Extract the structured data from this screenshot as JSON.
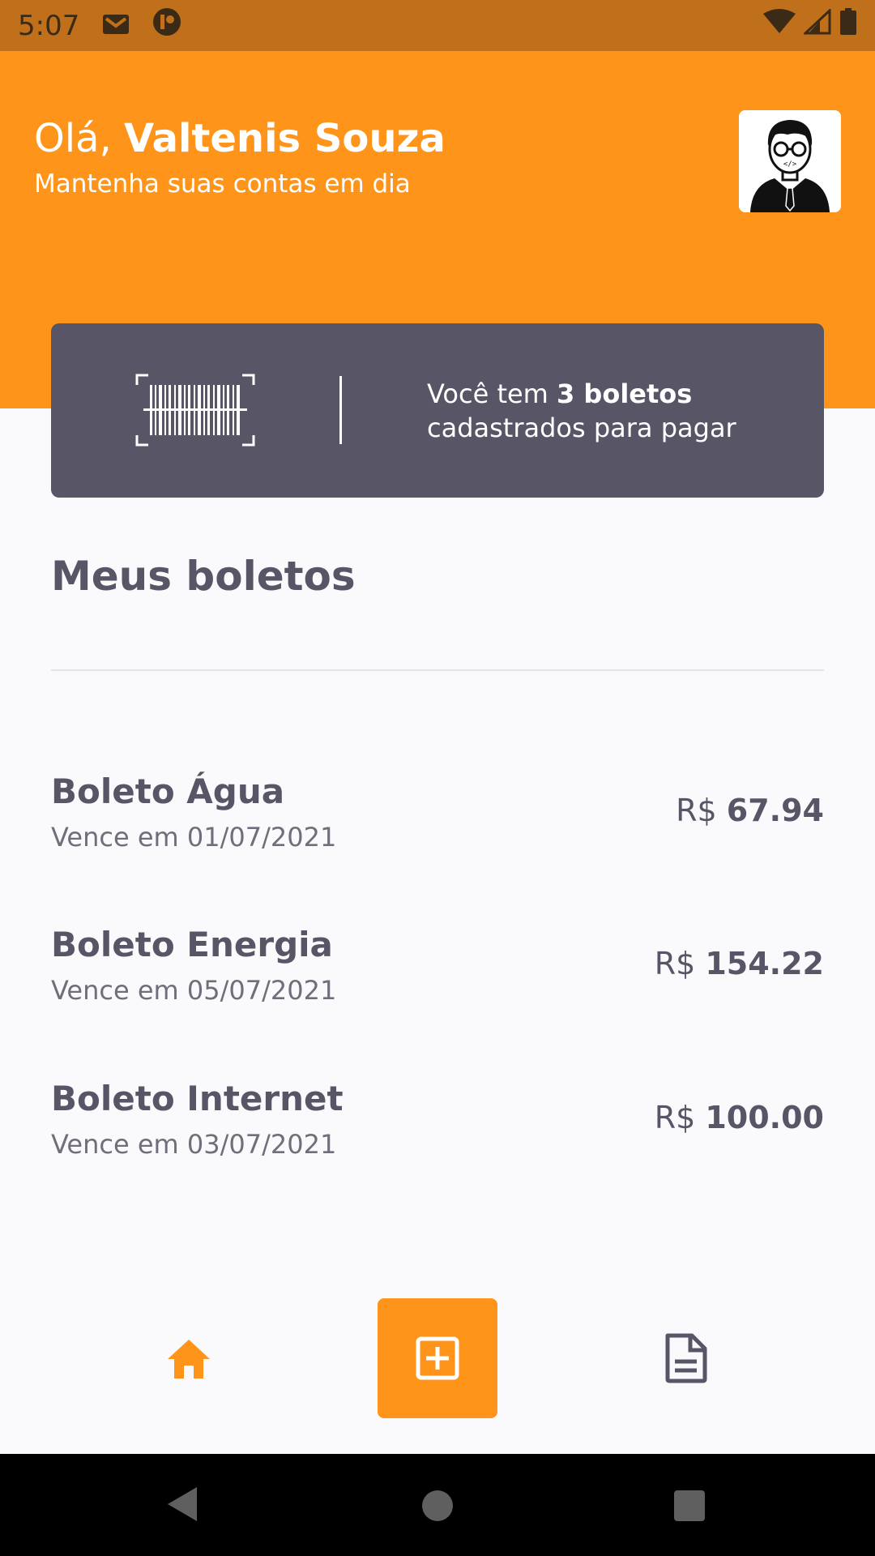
{
  "status_bar": {
    "time": "5:07",
    "icons": [
      "gmail-icon",
      "app-notification-icon",
      "wifi-icon",
      "signal-icon",
      "battery-icon"
    ]
  },
  "header": {
    "greeting_prefix": "Olá, ",
    "user_name": "Valtenis Souza",
    "subtitle": "Mantenha suas contas em dia",
    "avatar_icon": "developer-avatar-icon"
  },
  "banner": {
    "text_prefix": "Você tem ",
    "count_text": "3 boletos",
    "text_suffix": "cadastrados para pagar"
  },
  "section": {
    "title": "Meus boletos"
  },
  "boletos": [
    {
      "name": "Boleto Água",
      "due": "Vence em 01/07/2021",
      "currency": "R$ ",
      "amount": "67.94"
    },
    {
      "name": "Boleto Energia",
      "due": "Vence em 05/07/2021",
      "currency": "R$ ",
      "amount": "154.22"
    },
    {
      "name": "Boleto Internet",
      "due": "Vence em 03/07/2021",
      "currency": "R$ ",
      "amount": "100.00"
    }
  ],
  "bottom_nav": {
    "items": [
      "home-icon",
      "add-boleto-icon",
      "document-icon"
    ]
  },
  "colors": {
    "primary": "#FF941A",
    "status_bar": "#C0701A",
    "heading": "#585666",
    "body": "#706E7A",
    "background": "#FAFAFC"
  }
}
